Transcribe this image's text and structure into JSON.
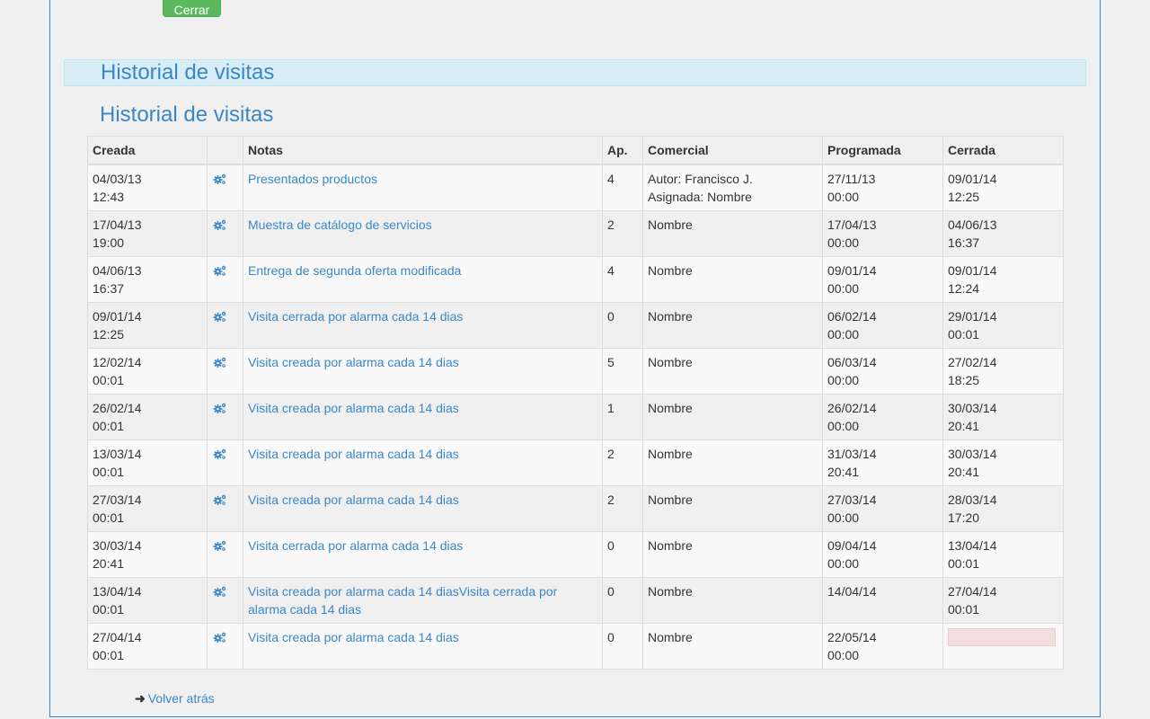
{
  "buttons": {
    "close_label": "Cerrar",
    "back_label": "Volver atrás"
  },
  "section": {
    "header_title": "Historial de visitas",
    "subtitle": "Historial de visitas"
  },
  "table": {
    "headers": [
      "Creada",
      "",
      "Notas",
      "Ap.",
      "Comercial",
      "Programada",
      "Cerrada"
    ],
    "rows": [
      {
        "created_date": "04/03/13",
        "created_time": "12:43",
        "note": "Presentados productos",
        "ap": "4",
        "commercial_1": "Autor: Francisco J.",
        "commercial_2": "Asignada: Nombre",
        "scheduled_date": "27/11/13",
        "scheduled_time": "00:00",
        "closed_date": "09/01/14",
        "closed_time": "12:25"
      },
      {
        "created_date": "17/04/13",
        "created_time": "19:00",
        "note": "Muestra de catálogo de servicios",
        "ap": "2",
        "commercial_1": "Nombre",
        "commercial_2": "",
        "scheduled_date": "17/04/13",
        "scheduled_time": "00:00",
        "closed_date": "04/06/13",
        "closed_time": "16:37"
      },
      {
        "created_date": "04/06/13",
        "created_time": "16:37",
        "note": "Entrega de segunda oferta modificada",
        "ap": "4",
        "commercial_1": "Nombre",
        "commercial_2": "",
        "scheduled_date": "09/01/14",
        "scheduled_time": "00:00",
        "closed_date": "09/01/14",
        "closed_time": "12:24"
      },
      {
        "created_date": "09/01/14",
        "created_time": "12:25",
        "note": "Visita cerrada por alarma cada 14 dias",
        "ap": "0",
        "commercial_1": "Nombre",
        "commercial_2": "",
        "scheduled_date": "06/02/14",
        "scheduled_time": "00:00",
        "closed_date": "29/01/14",
        "closed_time": "00:01"
      },
      {
        "created_date": "12/02/14",
        "created_time": "00:01",
        "note": "Visita creada por alarma cada 14 dias",
        "ap": "5",
        "commercial_1": "Nombre",
        "commercial_2": "",
        "scheduled_date": "06/03/14",
        "scheduled_time": "00:00",
        "closed_date": "27/02/14",
        "closed_time": "18:25"
      },
      {
        "created_date": "26/02/14",
        "created_time": "00:01",
        "note": "Visita creada por alarma cada 14 dias",
        "ap": "1",
        "commercial_1": "Nombre",
        "commercial_2": "",
        "scheduled_date": "26/02/14",
        "scheduled_time": "00:00",
        "closed_date": "30/03/14",
        "closed_time": "20:41"
      },
      {
        "created_date": "13/03/14",
        "created_time": "00:01",
        "note": "Visita creada por alarma cada 14 dias",
        "ap": "2",
        "commercial_1": "Nombre",
        "commercial_2": "",
        "scheduled_date": "31/03/14",
        "scheduled_time": "20:41",
        "closed_date": "30/03/14",
        "closed_time": "20:41"
      },
      {
        "created_date": "27/03/14",
        "created_time": "00:01",
        "note": "Visita creada por alarma cada 14 dias",
        "ap": "2",
        "commercial_1": "Nombre",
        "commercial_2": "",
        "scheduled_date": "27/03/14",
        "scheduled_time": "00:00",
        "closed_date": "28/03/14",
        "closed_time": "17:20"
      },
      {
        "created_date": "30/03/14",
        "created_time": "20:41",
        "note": "Visita cerrada por alarma cada 14 dias",
        "ap": "0",
        "commercial_1": "Nombre",
        "commercial_2": "",
        "scheduled_date": "09/04/14",
        "scheduled_time": "00:00",
        "closed_date": "13/04/14",
        "closed_time": "00:01"
      },
      {
        "created_date": "13/04/14",
        "created_time": "00:01",
        "note": "Visita creada por alarma cada 14 diasVisita cerrada por alarma cada 14 dias",
        "ap": "0",
        "commercial_1": "Nombre",
        "commercial_2": "",
        "scheduled_date": "14/04/14",
        "scheduled_time": "",
        "closed_date": "27/04/14",
        "closed_time": "00:01"
      },
      {
        "created_date": "27/04/14",
        "created_time": "00:01",
        "note": "Visita creada por alarma cada 14 dias",
        "ap": "0",
        "commercial_1": "Nombre",
        "commercial_2": "",
        "scheduled_date": "22/05/14",
        "scheduled_time": "00:00",
        "closed_date": "",
        "closed_time": ""
      }
    ]
  },
  "icons": {
    "row_action": "gears-icon",
    "back": "arrow-right-icon"
  },
  "colors": {
    "link": "#3a87c8",
    "button": "#5cb85c",
    "header_band": "#d9edf7",
    "empty_closed": "#f2dede"
  }
}
